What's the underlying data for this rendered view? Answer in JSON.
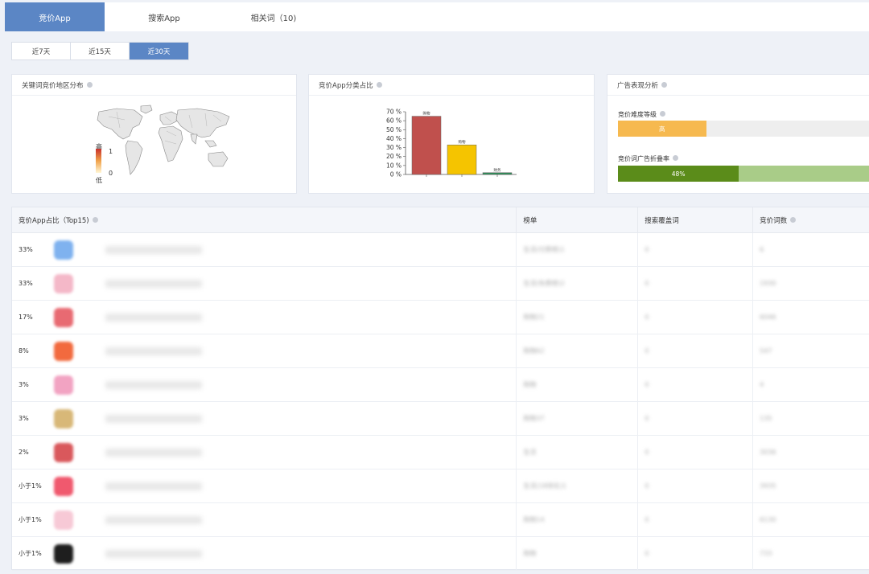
{
  "tabs": [
    "竞价App",
    "搜索App",
    "相关词（10)"
  ],
  "ranges": [
    "近7天",
    "近15天",
    "近30天"
  ],
  "colors": {
    "accent": "#5b86c5",
    "bar_red": "#c0504d",
    "bar_yellow": "#f5c400",
    "bar_green": "#2e8b57",
    "difficulty": "#f6b94f",
    "fold_rate": "#5b8c1a",
    "fold_rate_track": "#a9cc88"
  },
  "map_card": {
    "title": "关键词竞价地区分布",
    "legend_high": "高",
    "legend_low": "低",
    "legend_max": "1",
    "legend_min": "0"
  },
  "category_card": {
    "title": "竞价App分类占比"
  },
  "chart_data": {
    "type": "bar",
    "categories": [
      "",
      "",
      ""
    ],
    "values": [
      65,
      33,
      2
    ],
    "data_labels": [
      "购物",
      "购物",
      "财务"
    ],
    "ylim": [
      0,
      70
    ],
    "yticks": [
      "0 %",
      "10 %",
      "20 %",
      "30 %",
      "40 %",
      "50 %",
      "60 %",
      "70 %"
    ],
    "bar_colors": [
      "#c0504d",
      "#f5c400",
      "#2e8b57"
    ],
    "grid": false
  },
  "ad_card": {
    "title": "广告表现分析",
    "difficulty_label": "竞价难度等级",
    "difficulty_value": "高",
    "difficulty_fraction": 0.35,
    "fold_label": "竞价词广告折叠率",
    "fold_value": "48%",
    "fold_fraction": 0.48
  },
  "table": {
    "headers": [
      "竞价App占比（Top15)",
      "榜单",
      "搜索覆盖词",
      "竞价词数"
    ],
    "rows": [
      {
        "pct": "33%",
        "icon": "#7fb2ef",
        "rank": "生活(付费榜)1",
        "cover": "0",
        "bids": "6"
      },
      {
        "pct": "33%",
        "icon": "#f4b8c8",
        "rank": "生活(免费榜)2",
        "cover": "0",
        "bids": "1930"
      },
      {
        "pct": "17%",
        "icon": "#e86a72",
        "rank": "购物21",
        "cover": "0",
        "bids": "6046"
      },
      {
        "pct": "8%",
        "icon": "#f26a3e",
        "rank": "购物62",
        "cover": "0",
        "bids": "547"
      },
      {
        "pct": "3%",
        "icon": "#f2a3c2",
        "rank": "购物",
        "cover": "0",
        "bids": "4"
      },
      {
        "pct": "3%",
        "icon": "#d8b878",
        "rank": "购物37",
        "cover": "0",
        "bids": "135"
      },
      {
        "pct": "2%",
        "icon": "#d9585c",
        "rank": "生活",
        "cover": "0",
        "bids": "3036"
      },
      {
        "pct": "小于1%",
        "icon": "#f0596e",
        "rank": "生活(18排名)1",
        "cover": "0",
        "bids": "3935"
      },
      {
        "pct": "小于1%",
        "icon": "#f7c9d6",
        "rank": "购物14",
        "cover": "0",
        "bids": "6130"
      },
      {
        "pct": "小于1%",
        "icon": "#1e1e1e",
        "rank": "购物",
        "cover": "0",
        "bids": "733"
      }
    ]
  }
}
